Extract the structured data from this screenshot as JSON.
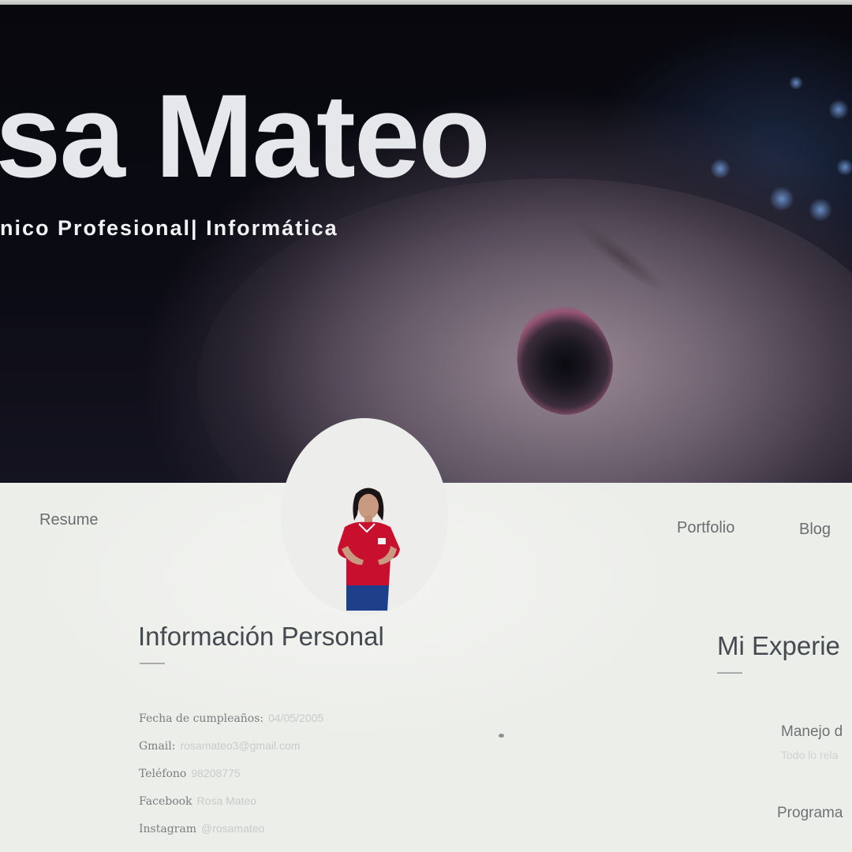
{
  "hero": {
    "name": "sa Mateo",
    "subtitle": "nico Profesional| Informática"
  },
  "nav": {
    "left": [
      "Resume"
    ],
    "right": [
      "Portfolio",
      "Blog"
    ]
  },
  "personal": {
    "title": "Información Personal",
    "rows": [
      {
        "label": "Fecha de cumpleaños:",
        "value": "04/05/2005"
      },
      {
        "label": "Gmail:",
        "value": "rosamateo3@gmail.com"
      },
      {
        "label": "Teléfono",
        "value": "98208775"
      },
      {
        "label": "Facebook",
        "value": "Rosa Mateo"
      },
      {
        "label": "Instagram",
        "value": "@rosamateo"
      }
    ]
  },
  "experience": {
    "title": "Mi Experie",
    "items": [
      {
        "title": "Manejo d",
        "subtitle": "Todo lo rela"
      },
      {
        "title": "Programa",
        "subtitle": ""
      }
    ]
  },
  "colors": {
    "hero_bg": "#0b0b14",
    "hero_text": "#e6e7ea",
    "page_bg": "#eceeea",
    "heading_text": "#444a50",
    "nav_text": "#6b6e70",
    "avatar_shirt": "#c8102e",
    "avatar_pants": "#1e3f8a"
  },
  "icons": {
    "avatar": "profile-photo"
  }
}
